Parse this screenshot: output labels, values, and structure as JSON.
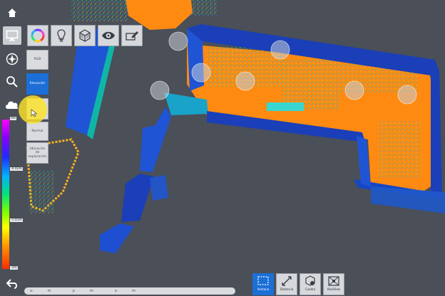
{
  "toolbar_left": {
    "items": [
      {
        "icon": "home-icon"
      },
      {
        "icon": "monitor-icon"
      },
      {
        "icon": "compass-icon"
      },
      {
        "icon": "search-icon"
      },
      {
        "icon": "cloud-icon"
      }
    ],
    "back_icon": "back-arrow-icon"
  },
  "toolbar_top": {
    "items": [
      {
        "icon": "color-wheel-icon"
      },
      {
        "icon": "lightbulb-icon"
      },
      {
        "icon": "cube-icon"
      },
      {
        "icon": "eye-icon"
      },
      {
        "icon": "tag-icon"
      }
    ]
  },
  "color_mode": {
    "options": [
      "RGB",
      "Elevación",
      "",
      "Normal",
      "Ubicación de exploración"
    ],
    "selected": "Elevación"
  },
  "legend": {
    "labels": [
      "0m",
      "-0.02m",
      "-1.01m",
      "-2m"
    ]
  },
  "bottom_toolbar": {
    "items": [
      {
        "label": "Ventana",
        "icon": "selection-window-icon",
        "active": true
      },
      {
        "label": "Distancia",
        "icon": "distance-icon",
        "active": false
      },
      {
        "label": "Cuadro",
        "icon": "box-icon",
        "active": false
      },
      {
        "label": "RealView",
        "icon": "realview-icon",
        "active": false
      }
    ]
  },
  "coordinates": {
    "x_label": "x:",
    "x_unit": "m",
    "y_label": "y:",
    "y_unit": "m",
    "z_label": "z:",
    "z_unit": "m"
  },
  "colors": {
    "accent": "#1b6fd6",
    "background": "#4a4f58",
    "cursor_highlight": "#fce228"
  }
}
